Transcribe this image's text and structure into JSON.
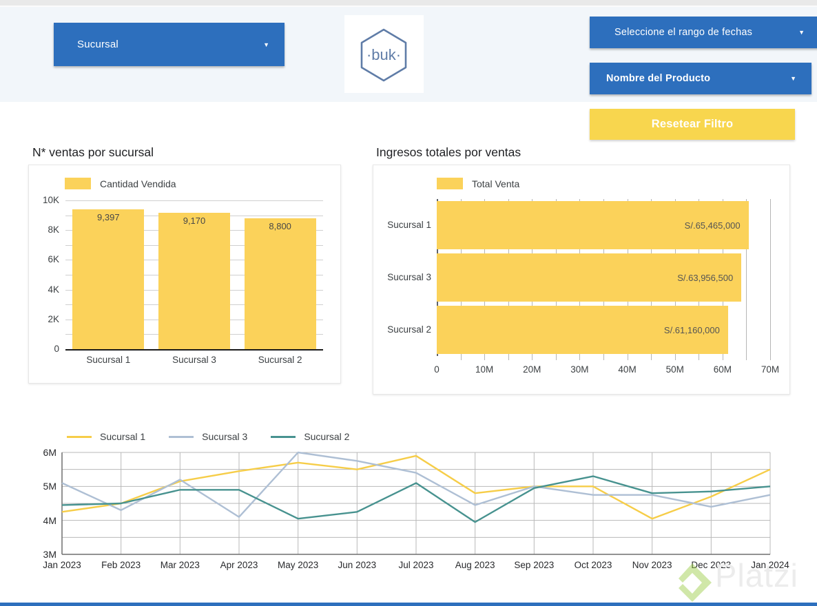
{
  "header": {
    "sucursal_filter": "Sucursal",
    "date_filter": "Seleccione el rango de fechas",
    "product_filter": "Nombre del Producto",
    "reset_button": "Resetear Filtro",
    "logo_text": "·buk·"
  },
  "colors": {
    "primary_blue": "#2D6FBD",
    "bar_yellow": "#FBD25A",
    "button_yellow": "#F8D64E",
    "line_yellow": "#F6CD48",
    "line_blue_gray": "#AEBFD4",
    "line_teal": "#47928F",
    "header_bg": "#F2F6FA",
    "logo_outline": "#5F7CA7",
    "watermark_green": "#97C93E"
  },
  "watermark": {
    "brand": "Platzi"
  },
  "chart_data": [
    {
      "type": "bar",
      "orientation": "vertical",
      "title": "N* ventas por sucursal",
      "legend": [
        "Cantidad Vendida"
      ],
      "categories": [
        "Sucursal 1",
        "Sucursal 3",
        "Sucursal 2"
      ],
      "values": [
        9397,
        9170,
        8800
      ],
      "value_labels": [
        "9,397",
        "9,170",
        "8,800"
      ],
      "y_ticks": {
        "labels": [
          "0",
          "2K",
          "4K",
          "6K",
          "8K",
          "10K"
        ],
        "values": [
          0,
          2000,
          4000,
          6000,
          8000,
          10000
        ]
      },
      "ylim": [
        0,
        10000
      ],
      "grid": "horizontal every 1000, labels every 2000"
    },
    {
      "type": "bar",
      "orientation": "horizontal",
      "title": "Ingresos totales por ventas",
      "legend": [
        "Total Venta"
      ],
      "categories": [
        "Sucursal 1",
        "Sucursal 3",
        "Sucursal 2"
      ],
      "values": [
        65465000,
        63956500,
        61160000
      ],
      "value_labels": [
        "S/.65,465,000",
        "S/.63,956,500",
        "S/.61,160,000"
      ],
      "x_ticks": {
        "labels": [
          "0",
          "10M",
          "20M",
          "30M",
          "40M",
          "50M",
          "60M",
          "70M"
        ],
        "values": [
          0,
          10,
          20,
          30,
          40,
          50,
          60,
          70
        ]
      },
      "xlim": [
        0,
        72900000
      ],
      "grid": "vertical every 5M, labels every 10M"
    },
    {
      "type": "line",
      "title": "",
      "unit": "M",
      "categories": [
        "Jan 2023",
        "Feb 2023",
        "Mar 2023",
        "Apr 2023",
        "May 2023",
        "Jun 2023",
        "Jul 2023",
        "Aug 2023",
        "Sep 2023",
        "Oct 2023",
        "Nov 2023",
        "Dec 2023",
        "Jan 2024"
      ],
      "series": [
        {
          "name": "Sucursal 1",
          "color": "#F6CD48",
          "values": [
            4.25,
            4.5,
            5.15,
            5.45,
            5.7,
            5.5,
            5.9,
            4.8,
            5.0,
            5.0,
            4.05,
            4.7,
            5.5
          ]
        },
        {
          "name": "Sucursal 3",
          "color": "#AEBFD4",
          "values": [
            5.1,
            4.3,
            5.2,
            4.1,
            6.0,
            5.75,
            5.4,
            4.45,
            5.0,
            4.75,
            4.75,
            4.4,
            4.75
          ]
        },
        {
          "name": "Sucursal 2",
          "color": "#47928F",
          "values": [
            4.45,
            4.5,
            4.9,
            4.9,
            4.05,
            4.25,
            5.1,
            3.95,
            4.95,
            5.3,
            4.8,
            4.85,
            5.0
          ]
        }
      ],
      "y_ticks": {
        "labels": [
          "6M",
          "5M",
          "4M",
          "3M"
        ],
        "values": [
          6,
          5,
          4,
          3
        ]
      },
      "ylim": [
        3,
        6
      ],
      "grid": "vertical every month, horizontal every 0.5M"
    }
  ]
}
